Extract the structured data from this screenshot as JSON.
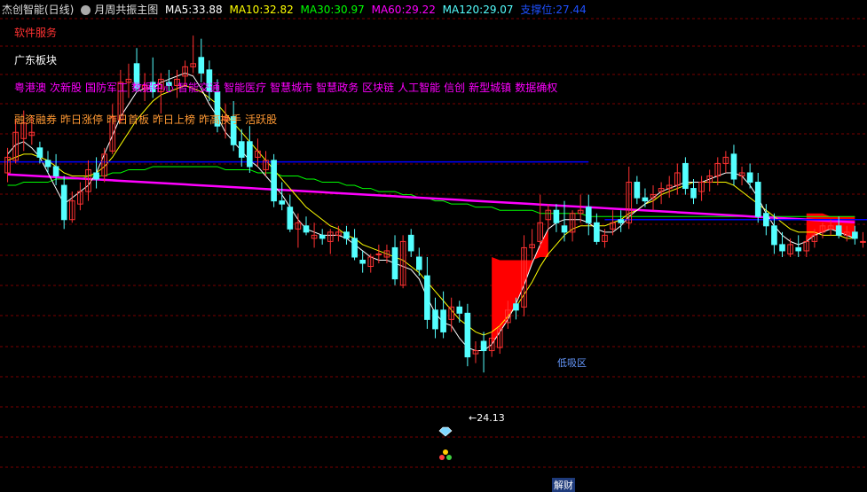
{
  "header": {
    "title": "杰创智能(日线)",
    "indicator": "月周共振主图",
    "ma5_label": "MA5:",
    "ma5_value": "33.88",
    "ma10_label": "MA10:",
    "ma10_value": "32.82",
    "ma30_label": "MA30:",
    "ma30_value": "30.97",
    "ma60_label": "MA60:",
    "ma60_value": "29.22",
    "ma120_label": "MA120:",
    "ma120_value": "29.07",
    "support_label": "支撑位:",
    "support_value": "27.44"
  },
  "info": {
    "software_service": "软件服务",
    "region": "广东板块",
    "concepts": [
      "粤港澳",
      "次新股",
      "国防军工",
      "数据中心",
      "智能交通",
      "智能医疗",
      "智慧城市",
      "智慧政务",
      "区块链",
      "人工智能",
      "信创",
      "新型城镇",
      "数据确权"
    ],
    "styles": [
      "融资融券",
      "昨日涨停",
      "昨日首板",
      "昨日上榜",
      "昨高换手",
      "活跃股"
    ]
  },
  "annotations": {
    "low_price": "24.13",
    "low_marker": "←",
    "support_tag": "低吸区",
    "bottom_tag": "解财"
  },
  "colors": {
    "up": "#ff3232",
    "down": "#54ffff",
    "ma5": "#ffffff",
    "ma10": "#ffff00",
    "ma30": "#00ff00",
    "ma60": "#ff00ff",
    "ma120": "#1e90ff",
    "support": "#0000ff",
    "cloud": "#ff0000",
    "grid": "#7a0000"
  },
  "chart_data": {
    "type": "candlestick",
    "candles": [
      {
        "o": 30.6,
        "h": 31.4,
        "l": 30.3,
        "c": 31.1
      },
      {
        "o": 31.0,
        "h": 32.3,
        "l": 30.9,
        "c": 31.9
      },
      {
        "o": 31.7,
        "h": 32.6,
        "l": 31.3,
        "c": 32.2
      },
      {
        "o": 31.8,
        "h": 32.4,
        "l": 31.5,
        "c": 31.9
      },
      {
        "o": 31.4,
        "h": 31.6,
        "l": 30.9,
        "c": 31.1
      },
      {
        "o": 31.0,
        "h": 31.3,
        "l": 30.6,
        "c": 30.8
      },
      {
        "o": 30.8,
        "h": 31.2,
        "l": 30.2,
        "c": 30.5
      },
      {
        "o": 30.2,
        "h": 30.5,
        "l": 28.8,
        "c": 29.1
      },
      {
        "o": 29.1,
        "h": 30.0,
        "l": 29.0,
        "c": 29.7
      },
      {
        "o": 29.6,
        "h": 30.3,
        "l": 29.4,
        "c": 30.0
      },
      {
        "o": 30.0,
        "h": 31.0,
        "l": 29.7,
        "c": 30.7
      },
      {
        "o": 30.6,
        "h": 31.1,
        "l": 30.1,
        "c": 30.4
      },
      {
        "o": 30.5,
        "h": 31.4,
        "l": 30.3,
        "c": 31.2
      },
      {
        "o": 31.3,
        "h": 32.8,
        "l": 31.2,
        "c": 32.4
      },
      {
        "o": 32.3,
        "h": 33.9,
        "l": 32.2,
        "c": 33.5
      },
      {
        "o": 33.5,
        "h": 34.1,
        "l": 33.0,
        "c": 33.6
      },
      {
        "o": 34.1,
        "h": 34.6,
        "l": 33.2,
        "c": 33.3
      },
      {
        "o": 33.3,
        "h": 33.8,
        "l": 32.9,
        "c": 33.4
      },
      {
        "o": 33.5,
        "h": 34.3,
        "l": 33.0,
        "c": 33.2
      },
      {
        "o": 33.2,
        "h": 33.8,
        "l": 32.5,
        "c": 33.6
      },
      {
        "o": 33.5,
        "h": 33.9,
        "l": 33.2,
        "c": 33.4
      },
      {
        "o": 33.4,
        "h": 33.9,
        "l": 33.0,
        "c": 33.6
      },
      {
        "o": 33.7,
        "h": 34.2,
        "l": 33.4,
        "c": 34.0
      },
      {
        "o": 34.0,
        "h": 35.0,
        "l": 33.8,
        "c": 34.1
      },
      {
        "o": 34.3,
        "h": 34.9,
        "l": 33.5,
        "c": 33.8
      },
      {
        "o": 33.9,
        "h": 34.2,
        "l": 32.9,
        "c": 33.2
      },
      {
        "o": 33.2,
        "h": 33.6,
        "l": 31.9,
        "c": 32.1
      },
      {
        "o": 32.3,
        "h": 32.8,
        "l": 31.7,
        "c": 32.4
      },
      {
        "o": 32.4,
        "h": 32.9,
        "l": 31.3,
        "c": 31.5
      },
      {
        "o": 31.6,
        "h": 32.0,
        "l": 30.8,
        "c": 31.1
      },
      {
        "o": 31.6,
        "h": 32.1,
        "l": 30.6,
        "c": 30.8
      },
      {
        "o": 31.1,
        "h": 31.7,
        "l": 30.8,
        "c": 31.3
      },
      {
        "o": 30.7,
        "h": 31.3,
        "l": 30.5,
        "c": 31.0
      },
      {
        "o": 31.0,
        "h": 31.2,
        "l": 29.5,
        "c": 29.7
      },
      {
        "o": 29.7,
        "h": 30.3,
        "l": 29.4,
        "c": 29.6
      },
      {
        "o": 29.5,
        "h": 29.9,
        "l": 28.7,
        "c": 28.8
      },
      {
        "o": 28.8,
        "h": 29.3,
        "l": 28.2,
        "c": 29.0
      },
      {
        "o": 28.9,
        "h": 29.2,
        "l": 28.6,
        "c": 28.7
      },
      {
        "o": 28.5,
        "h": 29.0,
        "l": 28.2,
        "c": 28.6
      },
      {
        "o": 28.6,
        "h": 28.8,
        "l": 28.3,
        "c": 28.5
      },
      {
        "o": 28.4,
        "h": 28.8,
        "l": 28.0,
        "c": 28.7
      },
      {
        "o": 28.6,
        "h": 28.9,
        "l": 28.4,
        "c": 28.7
      },
      {
        "o": 28.7,
        "h": 28.9,
        "l": 28.3,
        "c": 28.5
      },
      {
        "o": 28.5,
        "h": 28.8,
        "l": 27.8,
        "c": 27.9
      },
      {
        "o": 27.8,
        "h": 28.1,
        "l": 27.4,
        "c": 27.7
      },
      {
        "o": 27.6,
        "h": 28.0,
        "l": 27.4,
        "c": 27.9
      },
      {
        "o": 28.0,
        "h": 28.3,
        "l": 27.7,
        "c": 28.0
      },
      {
        "o": 27.9,
        "h": 28.3,
        "l": 27.7,
        "c": 28.1
      },
      {
        "o": 28.2,
        "h": 28.6,
        "l": 27.0,
        "c": 27.2
      },
      {
        "o": 27.0,
        "h": 28.6,
        "l": 26.9,
        "c": 28.4
      },
      {
        "o": 28.6,
        "h": 28.8,
        "l": 27.9,
        "c": 28.1
      },
      {
        "o": 27.9,
        "h": 28.2,
        "l": 27.3,
        "c": 27.5
      },
      {
        "o": 27.3,
        "h": 27.9,
        "l": 25.6,
        "c": 25.9
      },
      {
        "o": 26.2,
        "h": 26.6,
        "l": 25.3,
        "c": 25.6
      },
      {
        "o": 26.2,
        "h": 26.8,
        "l": 25.3,
        "c": 25.5
      },
      {
        "o": 25.9,
        "h": 26.6,
        "l": 25.5,
        "c": 26.3
      },
      {
        "o": 26.3,
        "h": 26.5,
        "l": 25.8,
        "c": 26.1
      },
      {
        "o": 26.1,
        "h": 26.4,
        "l": 24.4,
        "c": 24.7
      },
      {
        "o": 24.8,
        "h": 25.2,
        "l": 24.5,
        "c": 24.9
      },
      {
        "o": 25.2,
        "h": 25.5,
        "l": 24.2,
        "c": 24.9
      },
      {
        "o": 24.9,
        "h": 25.5,
        "l": 24.7,
        "c": 25.3
      },
      {
        "o": 25.0,
        "h": 25.7,
        "l": 24.8,
        "c": 25.6
      },
      {
        "o": 25.8,
        "h": 26.5,
        "l": 25.6,
        "c": 26.2
      },
      {
        "o": 26.4,
        "h": 26.6,
        "l": 25.9,
        "c": 26.2
      },
      {
        "o": 26.3,
        "h": 28.6,
        "l": 26.0,
        "c": 28.2
      },
      {
        "o": 28.2,
        "h": 28.8,
        "l": 27.8,
        "c": 28.3
      },
      {
        "o": 28.4,
        "h": 29.9,
        "l": 28.2,
        "c": 29.0
      },
      {
        "o": 29.1,
        "h": 29.6,
        "l": 28.8,
        "c": 29.4
      },
      {
        "o": 29.4,
        "h": 29.6,
        "l": 28.7,
        "c": 29.0
      },
      {
        "o": 28.9,
        "h": 29.7,
        "l": 28.4,
        "c": 28.7
      },
      {
        "o": 28.7,
        "h": 29.4,
        "l": 28.4,
        "c": 29.3
      },
      {
        "o": 29.3,
        "h": 29.9,
        "l": 29.0,
        "c": 29.4
      },
      {
        "o": 29.5,
        "h": 29.9,
        "l": 28.6,
        "c": 29.0
      },
      {
        "o": 29.0,
        "h": 29.3,
        "l": 28.3,
        "c": 28.4
      },
      {
        "o": 28.4,
        "h": 28.8,
        "l": 28.2,
        "c": 28.6
      },
      {
        "o": 28.8,
        "h": 29.4,
        "l": 28.6,
        "c": 29.0
      },
      {
        "o": 29.1,
        "h": 29.4,
        "l": 28.7,
        "c": 29.0
      },
      {
        "o": 29.0,
        "h": 30.8,
        "l": 28.8,
        "c": 30.3
      },
      {
        "o": 30.3,
        "h": 30.5,
        "l": 29.6,
        "c": 29.8
      },
      {
        "o": 29.8,
        "h": 30.1,
        "l": 29.5,
        "c": 29.7
      },
      {
        "o": 29.8,
        "h": 30.2,
        "l": 29.4,
        "c": 29.9
      },
      {
        "o": 30.0,
        "h": 30.3,
        "l": 29.6,
        "c": 30.1
      },
      {
        "o": 30.1,
        "h": 30.5,
        "l": 29.8,
        "c": 30.2
      },
      {
        "o": 30.2,
        "h": 30.9,
        "l": 29.9,
        "c": 30.6
      },
      {
        "o": 30.9,
        "h": 31.1,
        "l": 29.9,
        "c": 30.1
      },
      {
        "o": 30.1,
        "h": 30.4,
        "l": 29.6,
        "c": 29.8
      },
      {
        "o": 30.0,
        "h": 30.5,
        "l": 29.7,
        "c": 30.3
      },
      {
        "o": 30.3,
        "h": 30.7,
        "l": 30.0,
        "c": 30.5
      },
      {
        "o": 30.5,
        "h": 31.1,
        "l": 30.2,
        "c": 30.9
      },
      {
        "o": 30.9,
        "h": 31.3,
        "l": 30.6,
        "c": 31.1
      },
      {
        "o": 31.2,
        "h": 31.5,
        "l": 30.2,
        "c": 30.4
      },
      {
        "o": 30.5,
        "h": 30.8,
        "l": 30.2,
        "c": 30.6
      },
      {
        "o": 30.6,
        "h": 30.9,
        "l": 30.1,
        "c": 30.3
      },
      {
        "o": 30.3,
        "h": 30.6,
        "l": 29.0,
        "c": 29.2
      },
      {
        "o": 29.3,
        "h": 29.6,
        "l": 28.6,
        "c": 28.9
      },
      {
        "o": 28.9,
        "h": 29.3,
        "l": 28.0,
        "c": 28.3
      },
      {
        "o": 28.3,
        "h": 28.7,
        "l": 27.9,
        "c": 28.1
      },
      {
        "o": 28.0,
        "h": 28.5,
        "l": 27.9,
        "c": 28.3
      },
      {
        "o": 28.2,
        "h": 28.6,
        "l": 27.9,
        "c": 28.1
      },
      {
        "o": 28.1,
        "h": 28.6,
        "l": 27.9,
        "c": 28.4
      },
      {
        "o": 28.4,
        "h": 28.8,
        "l": 28.2,
        "c": 28.6
      },
      {
        "o": 28.7,
        "h": 29.0,
        "l": 28.5,
        "c": 28.9
      },
      {
        "o": 28.8,
        "h": 29.1,
        "l": 28.6,
        "c": 28.9
      },
      {
        "o": 28.9,
        "h": 29.2,
        "l": 28.5,
        "c": 28.6
      },
      {
        "o": 28.6,
        "h": 28.9,
        "l": 28.4,
        "c": 28.7
      },
      {
        "o": 28.7,
        "h": 28.9,
        "l": 28.3,
        "c": 28.5
      },
      {
        "o": 28.4,
        "h": 28.7,
        "l": 28.2,
        "c": 28.4
      }
    ],
    "ma5": [
      31.2,
      31.5,
      31.6,
      31.4,
      31.1,
      30.6,
      30.1,
      29.6,
      29.8,
      30.0,
      30.2,
      30.6,
      31.2,
      31.8,
      32.4,
      32.8,
      33.2,
      33.3,
      33.3,
      33.5,
      33.6,
      33.7,
      33.8,
      33.7,
      33.3,
      32.8,
      32.4,
      31.9,
      31.6,
      31.3,
      31.0,
      30.8,
      30.5,
      30.2,
      29.9,
      29.5,
      29.1,
      28.8,
      28.7,
      28.6,
      28.6,
      28.6,
      28.5,
      28.3,
      28.1,
      27.9,
      27.8,
      27.8,
      27.7,
      27.6,
      27.5,
      27.2,
      26.6,
      26.1,
      25.8,
      25.7,
      25.3,
      25.0,
      24.9,
      24.9,
      25.1,
      25.5,
      25.9,
      26.4,
      27.0,
      27.7,
      28.3,
      28.8,
      29.0,
      29.1,
      29.1,
      29.1,
      29.0,
      28.8,
      28.7,
      28.7,
      28.9,
      29.2,
      29.4,
      29.6,
      29.8,
      30.0,
      30.1,
      30.2,
      30.3,
      30.3,
      30.3,
      30.4,
      30.5,
      30.6,
      30.6,
      30.5,
      30.2,
      29.8,
      29.3,
      28.9,
      28.6,
      28.4,
      28.3,
      28.4,
      28.6,
      28.7,
      28.8,
      28.7,
      28.6,
      28.5
    ],
    "ma10": [
      31.0,
      31.1,
      31.2,
      31.2,
      31.1,
      31.0,
      30.8,
      30.6,
      30.5,
      30.5,
      30.5,
      30.6,
      30.8,
      31.1,
      31.5,
      31.9,
      32.3,
      32.6,
      32.9,
      33.1,
      33.2,
      33.3,
      33.4,
      33.3,
      33.2,
      33.0,
      32.8,
      32.5,
      32.2,
      31.9,
      31.6,
      31.3,
      31.0,
      30.7,
      30.4,
      30.1,
      29.8,
      29.5,
      29.3,
      29.1,
      28.9,
      28.8,
      28.6,
      28.5,
      28.3,
      28.2,
      28.1,
      28.0,
      27.9,
      27.8,
      27.6,
      27.4,
      27.1,
      26.8,
      26.5,
      26.2,
      25.9,
      25.7,
      25.5,
      25.4,
      25.5,
      25.7,
      26.0,
      26.3,
      26.7,
      27.1,
      27.6,
      28.0,
      28.3,
      28.6,
      28.8,
      28.9,
      28.9,
      28.9,
      28.9,
      29.0,
      29.1,
      29.3,
      29.4,
      29.6,
      29.7,
      29.9,
      30.0,
      30.1,
      30.2,
      30.3,
      30.3,
      30.3,
      30.3,
      30.3,
      30.2,
      30.0,
      29.8,
      29.6,
      29.4,
      29.2,
      29.0,
      28.8,
      28.7,
      28.7,
      28.7,
      28.6,
      28.6,
      28.6,
      28.5,
      28.5
    ],
    "ma30": [
      30.5,
      30.5,
      30.5,
      30.5,
      30.6,
      30.6,
      30.6,
      30.6,
      30.7,
      30.7,
      30.8,
      30.8,
      30.9,
      31.0,
      31.1,
      31.2,
      31.3,
      31.4,
      31.5,
      31.6,
      31.6,
      31.7,
      31.7,
      31.8,
      31.8,
      31.8,
      31.8,
      31.8,
      31.8,
      31.7,
      31.6,
      31.6,
      31.5,
      31.4,
      31.3,
      31.2,
      31.1,
      31.0,
      30.9,
      30.7,
      30.6,
      30.4,
      30.3,
      30.1,
      30.0,
      29.8,
      29.6,
      29.5,
      29.3,
      29.2,
      29.0,
      28.9,
      28.7,
      28.6,
      28.4,
      28.3,
      28.2,
      28.1,
      28.0,
      27.9,
      27.9,
      27.8,
      27.8,
      27.8,
      27.8,
      27.8,
      27.9,
      27.9,
      28.0,
      28.1,
      28.2,
      28.3,
      28.3,
      28.4,
      28.5,
      28.6,
      28.7,
      28.8,
      28.9,
      29.0,
      29.1,
      29.2,
      29.3,
      29.4,
      29.5,
      29.6,
      29.6,
      29.7,
      29.7,
      29.7,
      29.7,
      29.7,
      29.7,
      29.6,
      29.6,
      29.5,
      29.5,
      29.4,
      29.4,
      29.3,
      29.3,
      29.3,
      29.2,
      29.2,
      29.2,
      29.2
    ],
    "ma60": [
      30.2,
      30.2,
      30.3,
      30.3,
      30.3,
      30.3,
      30.4,
      30.4,
      30.4,
      30.4,
      30.5,
      30.5,
      30.5,
      30.6,
      30.6,
      30.7,
      30.7,
      30.7,
      30.8,
      30.8,
      30.8,
      30.8,
      30.8,
      30.8,
      30.8,
      30.8,
      30.8,
      30.7,
      30.7,
      30.7,
      30.7,
      30.6,
      30.6,
      30.6,
      30.5,
      30.5,
      30.5,
      30.4,
      30.4,
      30.3,
      30.3,
      30.3,
      30.2,
      30.2,
      30.1,
      30.1,
      30.0,
      30.0,
      30.0,
      29.9,
      29.9,
      29.8,
      29.8,
      29.7,
      29.7,
      29.6,
      29.6,
      29.6,
      29.5,
      29.5,
      29.5,
      29.4,
      29.4,
      29.4,
      29.4,
      29.4,
      29.3,
      29.3,
      29.3,
      29.3,
      29.3,
      29.3,
      29.2,
      29.2,
      29.2,
      29.2,
      29.2,
      29.2,
      29.2,
      29.2,
      29.2,
      29.2,
      29.2,
      29.2,
      29.2,
      29.2,
      29.2,
      29.2,
      29.2,
      29.2,
      29.2,
      29.2,
      29.2,
      29.2,
      29.2,
      29.2,
      29.2,
      29.2,
      29.2,
      29.2,
      29.2,
      29.2,
      29.2,
      29.2,
      29.2,
      29.2
    ],
    "ma120_first": 30.95,
    "ma120_last": 30.95,
    "support_low_start": 24.6,
    "support_low_end": 24.6,
    "ymin": 22.5,
    "ymax": 35.8,
    "title": "",
    "xlabel": "",
    "ylabel": ""
  }
}
